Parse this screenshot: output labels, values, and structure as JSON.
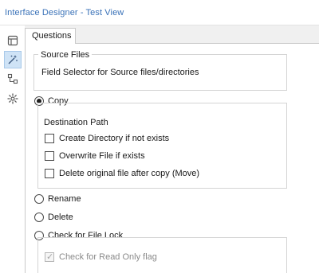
{
  "window": {
    "title": "Interface Designer - Test View"
  },
  "sidebar": {
    "items": [
      {
        "icon": "layout-icon",
        "active": false
      },
      {
        "icon": "magic-wand-icon",
        "active": true
      },
      {
        "icon": "tree-structure-icon",
        "active": false
      },
      {
        "icon": "gear-icon",
        "active": false
      }
    ]
  },
  "tabs": [
    {
      "label": "Questions",
      "active": true
    }
  ],
  "source_files": {
    "title": "Source Files",
    "selector_label": "Field Selector for Source files/directories"
  },
  "copy": {
    "label": "Copy",
    "selected": true,
    "destination_label": "Destination Path",
    "options": [
      {
        "label": "Create Directory if not exists",
        "checked": false
      },
      {
        "label": "Overwrite File if exists",
        "checked": false
      },
      {
        "label": "Delete original file after copy (Move)",
        "checked": false
      }
    ]
  },
  "rename": {
    "label": "Rename",
    "selected": false
  },
  "delete": {
    "label": "Delete",
    "selected": false
  },
  "file_lock": {
    "label": "Check for File Lock",
    "selected": false,
    "read_only_option": {
      "label": "Check for Read Only flag",
      "checked": true,
      "disabled": true
    }
  },
  "colors": {
    "title_text": "#3a72b8",
    "active_sidebar": "#cfe3f6",
    "panel_background": "#f0f0f0"
  }
}
